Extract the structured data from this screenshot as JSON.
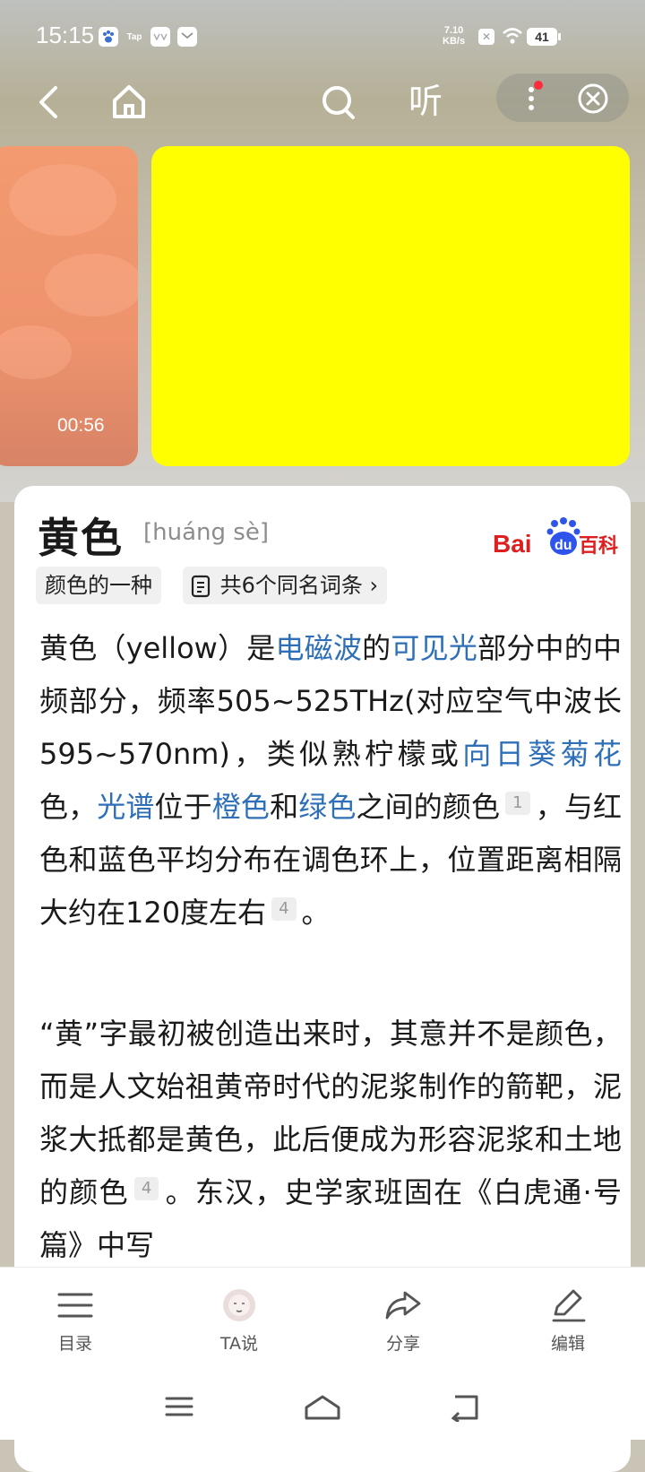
{
  "status_bar": {
    "time": "15:15",
    "apps": [
      "Tap"
    ],
    "net_speed_value": "7.10",
    "net_speed_unit": "KB/s",
    "battery": "41"
  },
  "nav": {
    "listen_label": "听"
  },
  "media": {
    "video_duration": "00:56",
    "color_swatch": "#ffff00"
  },
  "entry": {
    "title": "黄色",
    "pinyin": "[huáng sè]",
    "logo_text_a": "Bai",
    "logo_text_b": "du",
    "logo_text_c": "百科",
    "tag_type": "颜色的一种",
    "tag_homonyms": "共6个同名词条",
    "p1": {
      "a": "黄色（yellow）是",
      "link1": "电磁波",
      "b": "的",
      "link2": "可见光",
      "c": "部分中的中频部分，频率505~525THz(对应空气中波长595~570nm)，类似熟柠檬或",
      "link3": "向日葵菊花",
      "d": "色，",
      "link4": "光谱",
      "e": "位于",
      "link5": "橙色",
      "f": "和",
      "link6": "绿色",
      "g": "之间的颜色",
      "ref1": "1",
      "h": "，与红色和蓝色平均分布在调色环上，位置距离相隔大约在120度左右",
      "ref2": "4",
      "i": "。"
    },
    "p2": {
      "a": "“黄”字最初被创造出来时，其意并不是颜色，而是人文始祖黄帝时代的泥浆制作的箭靶，泥浆大抵都是黄色，此后便成为形容泥浆和土地的颜色",
      "ref": "4",
      "b": "。东汉，史学家班固在《白虎通·号篇》中写"
    }
  },
  "bottom_tabs": [
    {
      "label": "目录"
    },
    {
      "label": "TA说"
    },
    {
      "label": "分享"
    },
    {
      "label": "编辑"
    }
  ]
}
